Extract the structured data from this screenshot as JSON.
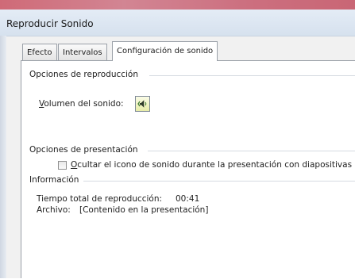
{
  "window": {
    "title": "Reproducir Sonido"
  },
  "tabs": [
    {
      "label": "Efecto"
    },
    {
      "label": "Intervalos"
    },
    {
      "label": "Configuración de sonido",
      "selected": true
    }
  ],
  "playback_options": {
    "group_label": "Opciones de reproducción",
    "volume_label_accel": "V",
    "volume_label_rest": "olumen del sonido:",
    "volume_icon": "speaker-icon"
  },
  "display_options": {
    "group_label": "Opciones de presentación",
    "hide_icon_label_accel": "O",
    "hide_icon_label_rest": "cultar el icono de sonido durante la presentación con diapositivas",
    "hide_icon_checked": false
  },
  "information": {
    "group_label": "Información",
    "total_play_time_label": "Tiempo total de reproducción:",
    "total_play_time_value": "00:41",
    "file_label": "Archivo:",
    "file_value": "[Contenido en la presentación]"
  },
  "colors": {
    "title_bar": "#d6e1ee",
    "panel": "#ffffff",
    "volume_button": "#e8eda8"
  }
}
